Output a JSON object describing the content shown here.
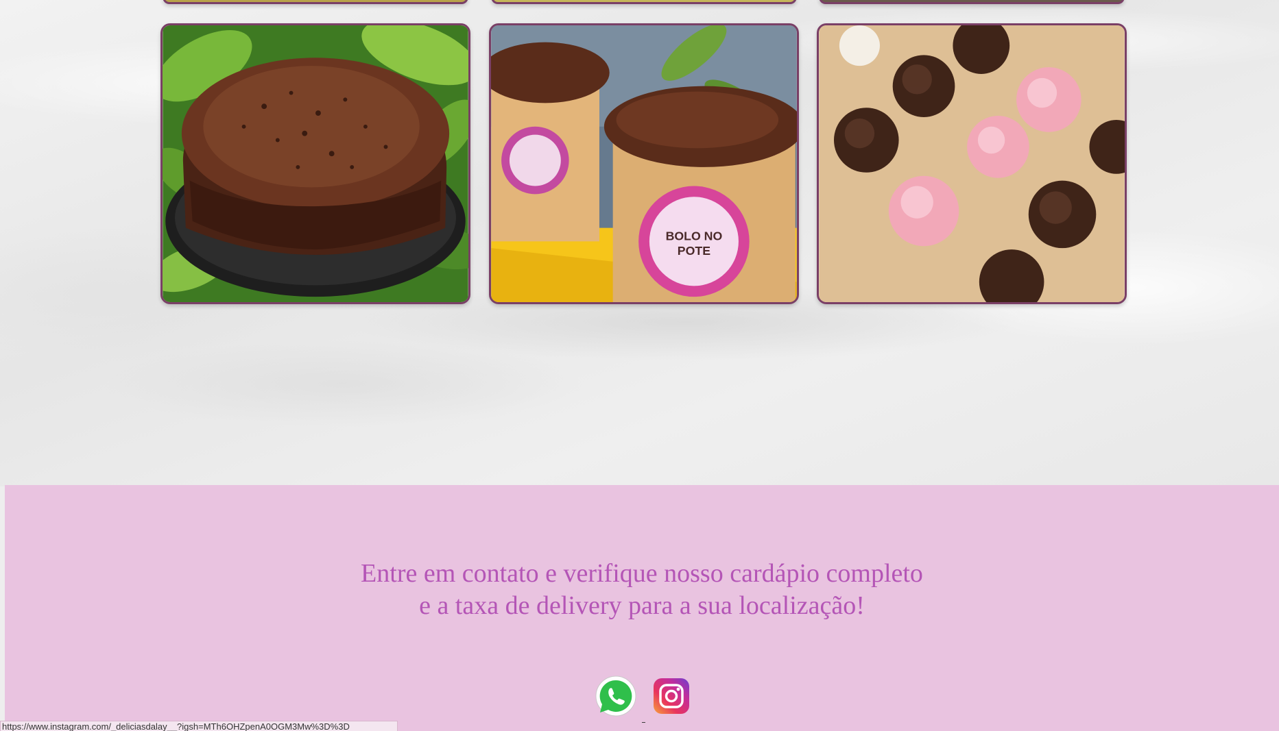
{
  "gallery": {
    "items": [
      {
        "name": "chocolate-cake-photo",
        "alt": "Bolo de chocolate com granulado"
      },
      {
        "name": "bolo-no-pote-photo",
        "alt": "Bolo no pote"
      },
      {
        "name": "brigadeiros-photo",
        "alt": "Brigadeiros e docinhos"
      }
    ]
  },
  "contact": {
    "line1": "Entre em contato e verifique nosso cardápio completo",
    "line2": "e a taxa de delivery para a sua localização!",
    "whatsapp_icon": "whatsapp-icon",
    "instagram_icon": "instagram-icon",
    "text_color": "#b455b6",
    "background_color": "#e9c3e0"
  },
  "status_bar": {
    "url": "https://www.instagram.com/_deliciasdalay__?igsh=MTh6OHZpenA0OGM3Mw%3D%3D"
  },
  "colors": {
    "card_border": "#7a3f66"
  }
}
